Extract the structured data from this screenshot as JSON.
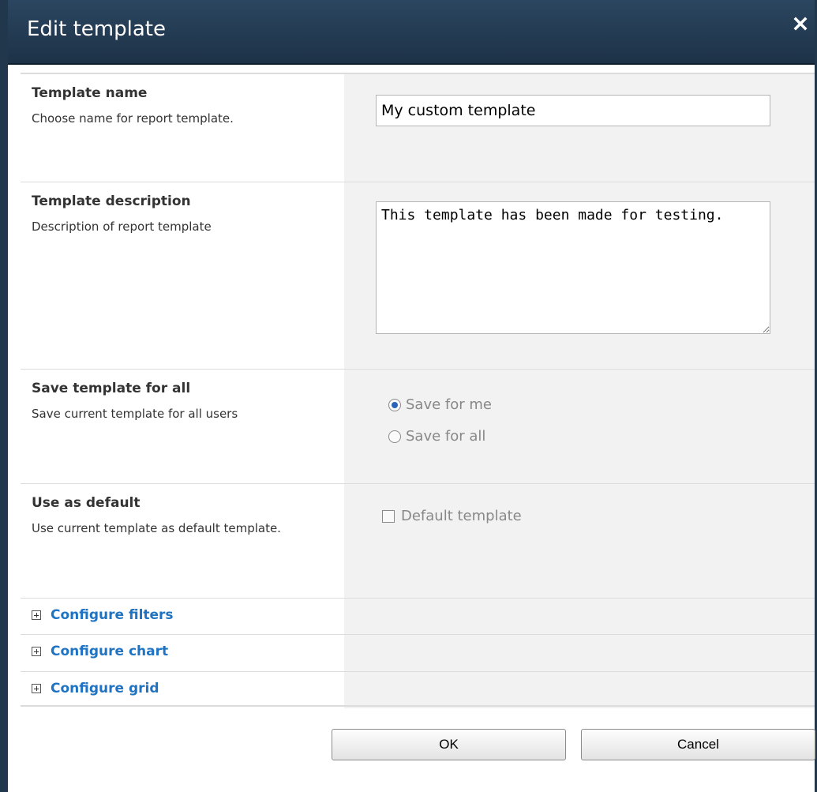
{
  "dialog": {
    "title": "Edit template"
  },
  "sections": {
    "name": {
      "title": "Template name",
      "description": "Choose name for report template.",
      "value": "My custom template"
    },
    "description": {
      "title": "Template description",
      "description": "Description of report template",
      "value": "This template has been made for testing."
    },
    "save_for": {
      "title": "Save template for all",
      "description": "Save current template for all users",
      "options": [
        {
          "label": "Save for me",
          "checked": true
        },
        {
          "label": "Save for all",
          "checked": false
        }
      ]
    },
    "default": {
      "title": "Use as default",
      "description": "Use current template as default template.",
      "checkbox_label": "Default template",
      "checked": false
    }
  },
  "expanders": [
    {
      "label": "Configure filters",
      "icon": "plus-box-icon"
    },
    {
      "label": "Configure chart",
      "icon": "plus-box-icon"
    },
    {
      "label": "Configure grid",
      "icon": "plus-box-icon"
    }
  ],
  "buttons": {
    "ok": "OK",
    "cancel": "Cancel"
  },
  "colors": {
    "titlebar": "#21374c",
    "link": "#1f73c2",
    "panel": "#f2f2f2"
  }
}
